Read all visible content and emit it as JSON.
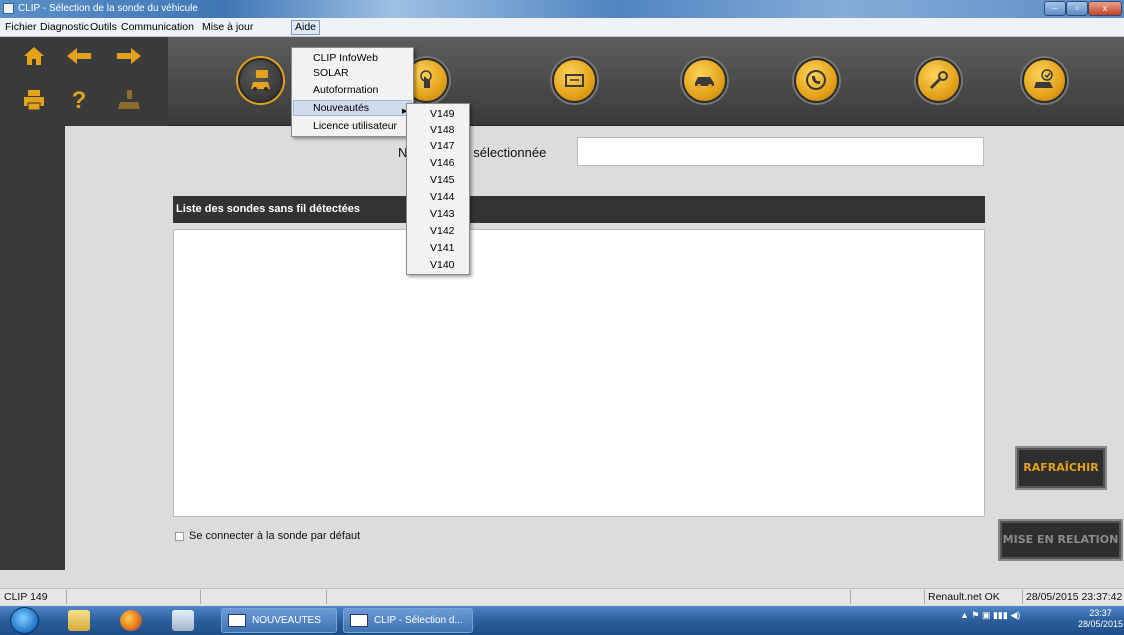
{
  "window": {
    "title": "CLIP - Sélection de la sonde du véhicule",
    "controls": {
      "minimize": "–",
      "maximize": "▫",
      "close": "x"
    }
  },
  "menubar": {
    "items": [
      "Fichier",
      "Diagnostic",
      "Outils",
      "Communication",
      "Mise à jour",
      "Aide"
    ],
    "open_item": "Aide"
  },
  "aide_menu": {
    "items": [
      "CLIP InfoWeb",
      "SOLAR",
      "Autoformation",
      "Nouveautés",
      "Licence utilisateur"
    ],
    "highlighted": "Nouveautés"
  },
  "nouveautes_submenu": {
    "items": [
      "V149",
      "V148",
      "V147",
      "V146",
      "V145",
      "V144",
      "V143",
      "V142",
      "V141",
      "V140"
    ]
  },
  "toolbar": {
    "nav_icons": [
      "home-icon",
      "back-arrow-icon",
      "forward-arrow-icon",
      "printer-icon",
      "help-icon",
      "vehicle-probe-icon"
    ],
    "modules": [
      "vehicle-identification-icon",
      "touch-icon",
      "ecu-icon",
      "vehicle-icon",
      "phone-assistance-icon",
      "wrench-icon",
      "vehicle-check-icon"
    ],
    "accent_color": "#e3a21a"
  },
  "main": {
    "probe_label": "N° de sonde sélectionnée",
    "probe_value": "",
    "list_header": "Liste des sondes sans fil détectées",
    "list_items": [],
    "default_probe_checkbox": "Se connecter à la sonde par défaut",
    "default_probe_checked": false,
    "refresh_button": "RAFRAÎCHIR",
    "connect_button": "MISE EN RELATION"
  },
  "statusbar": {
    "version": "CLIP 149",
    "connection": "Renault.net OK",
    "datetime": "28/05/2015 23:37:42"
  },
  "taskbar": {
    "tasks": [
      "NOUVEAUTES DE ...",
      "CLIP - Sélection d..."
    ],
    "clock_time": "23:37",
    "clock_date": "28/05/2015"
  }
}
